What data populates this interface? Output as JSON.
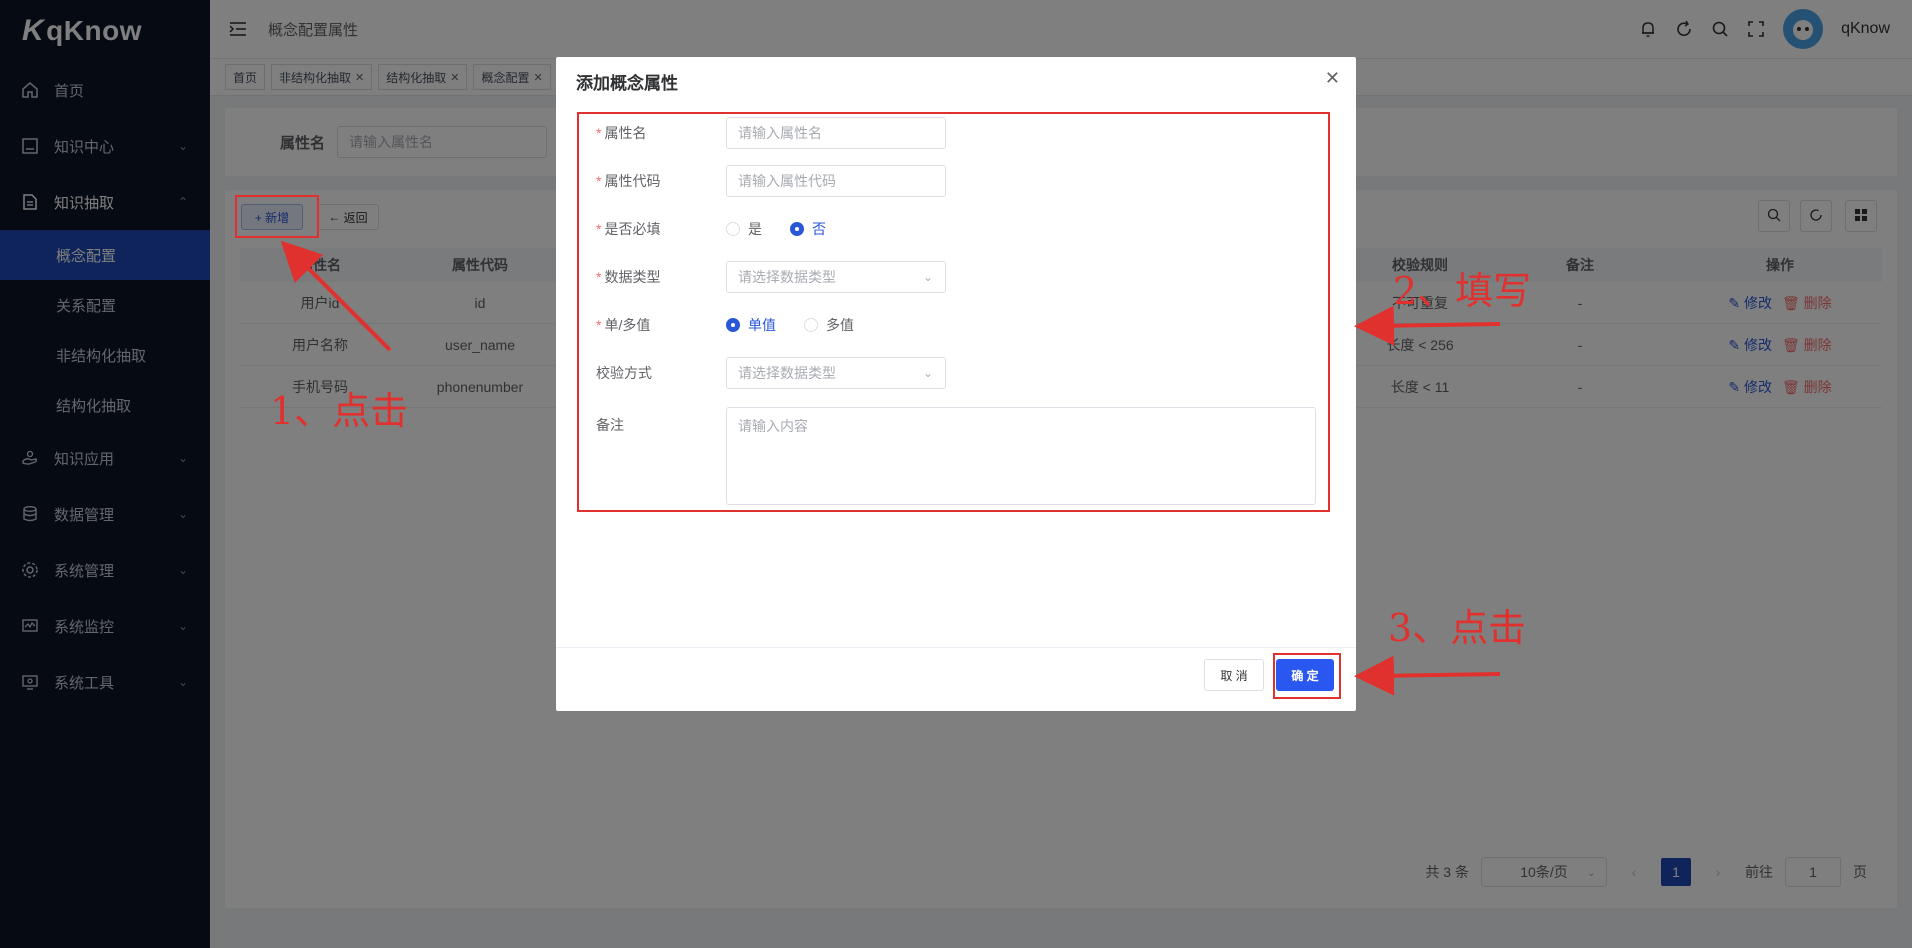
{
  "app": {
    "name": "qKnow"
  },
  "sidebar": {
    "items": [
      {
        "label": "首页",
        "icon": "home-icon"
      },
      {
        "label": "知识中心",
        "icon": "book-icon",
        "expandable": true
      },
      {
        "label": "知识抽取",
        "icon": "document-icon",
        "expandable": true,
        "open": true,
        "children": [
          {
            "label": "概念配置",
            "active": true
          },
          {
            "label": "关系配置"
          },
          {
            "label": "非结构化抽取"
          },
          {
            "label": "结构化抽取"
          }
        ]
      },
      {
        "label": "知识应用",
        "icon": "hand-icon",
        "expandable": true
      },
      {
        "label": "数据管理",
        "icon": "database-icon",
        "expandable": true
      },
      {
        "label": "系统管理",
        "icon": "gear-icon",
        "expandable": true
      },
      {
        "label": "系统监控",
        "icon": "monitor-icon",
        "expandable": true
      },
      {
        "label": "系统工具",
        "icon": "tool-icon",
        "expandable": true
      }
    ]
  },
  "header": {
    "title": "概念配置属性",
    "username": "qKnow"
  },
  "tags": [
    "首页",
    "非结构化抽取",
    "结构化抽取",
    "概念配置"
  ],
  "search": {
    "label": "属性名",
    "placeholder": "请输入属性名"
  },
  "toolbar": {
    "add_label": "+ 新增",
    "back_label": "返回"
  },
  "table": {
    "headers": {
      "name": "属性名",
      "code": "属性代码",
      "rule": "校验规则",
      "remark": "备注",
      "ops": "操作"
    },
    "rows": [
      {
        "name": "用户id",
        "code": "id",
        "rule": "不可重复",
        "remark": "-"
      },
      {
        "name": "用户名称",
        "code": "user_name",
        "rule": "长度 < 256",
        "remark": "-"
      },
      {
        "name": "手机号码",
        "code": "phonenumber",
        "rule": "长度 < 11",
        "remark": "-"
      }
    ],
    "edit_label": "修改",
    "delete_label": "删除"
  },
  "pagination": {
    "total": "共 3 条",
    "page_size": "10条/页",
    "current": "1",
    "goto_label": "前往",
    "goto_value": "1",
    "page_unit": "页"
  },
  "modal": {
    "title": "添加概念属性",
    "fields": {
      "name": {
        "label": "属性名",
        "placeholder": "请输入属性名"
      },
      "code": {
        "label": "属性代码",
        "placeholder": "请输入属性代码"
      },
      "required": {
        "label": "是否必填",
        "options": [
          "是",
          "否"
        ],
        "selected": "否"
      },
      "datatype": {
        "label": "数据类型",
        "placeholder": "请选择数据类型"
      },
      "multi": {
        "label": "单/多值",
        "options": [
          "单值",
          "多值"
        ],
        "selected": "单值"
      },
      "validation": {
        "label": "校验方式",
        "placeholder": "请选择数据类型"
      },
      "remark": {
        "label": "备注",
        "placeholder": "请输入内容"
      }
    },
    "cancel_label": "取 消",
    "ok_label": "确 定"
  },
  "annotations": {
    "step1": "1、点击",
    "step2": "2、填写",
    "step3": "3、点击",
    "color": "#e0312e"
  },
  "watermark": "qKnow"
}
